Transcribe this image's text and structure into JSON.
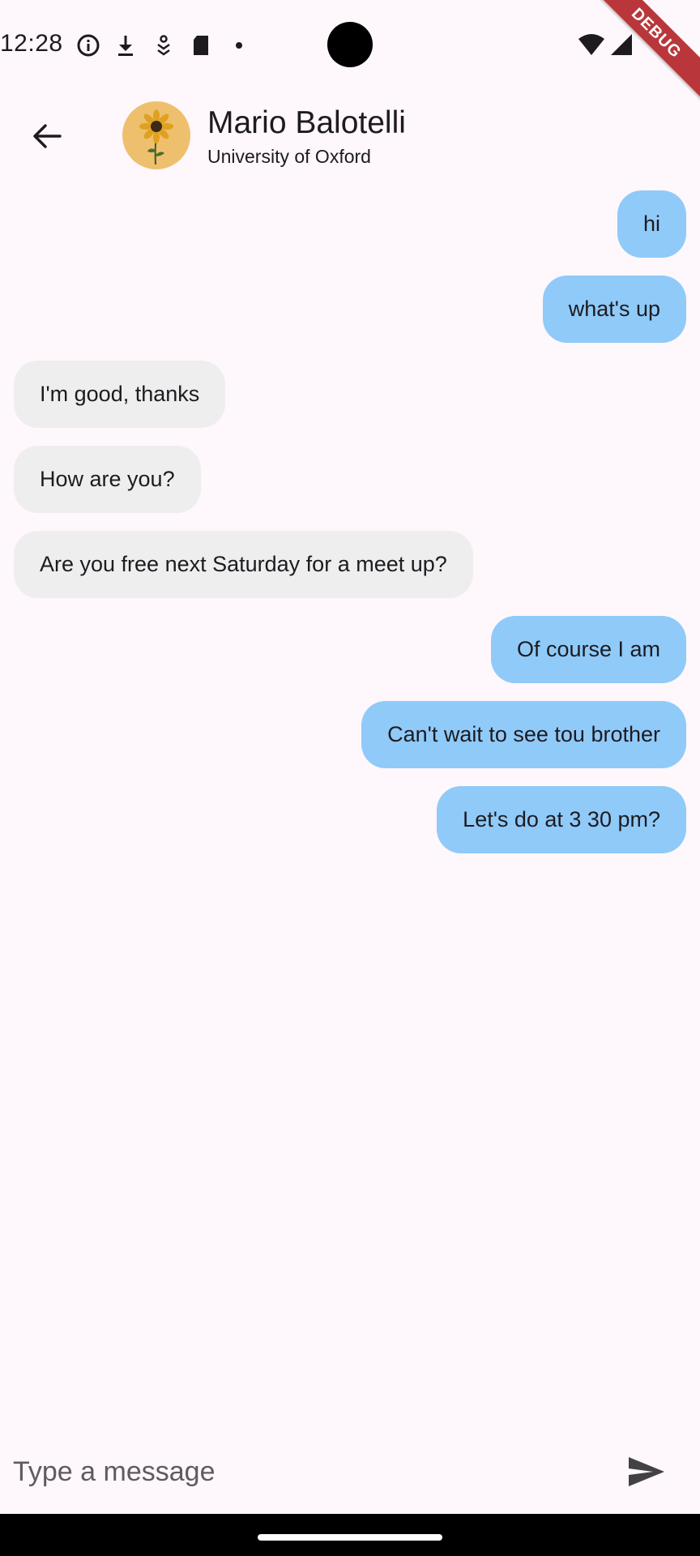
{
  "status_bar": {
    "time": "12:28",
    "icons": [
      "info-icon",
      "download-icon",
      "app-notification-icon",
      "sd-card-icon",
      "dot-icon",
      "wifi-icon",
      "signal-icon"
    ]
  },
  "debug_banner": {
    "label": "DEBUG",
    "color": "#b9373a"
  },
  "header": {
    "name": "Mario Balotelli",
    "subtitle": "University of Oxford",
    "avatar_icon": "sunflower-avatar"
  },
  "messages": [
    {
      "text": "hi",
      "direction": "sent"
    },
    {
      "text": "what's up",
      "direction": "sent"
    },
    {
      "text": "I'm good, thanks",
      "direction": "received"
    },
    {
      "text": "How are you?",
      "direction": "received"
    },
    {
      "text": "Are you free next Saturday for a meet up?",
      "direction": "received"
    },
    {
      "text": "Of course I am",
      "direction": "sent"
    },
    {
      "text": "Can't wait to see tou brother",
      "direction": "sent"
    },
    {
      "text": "Let's do at 3 30 pm?",
      "direction": "sent"
    }
  ],
  "composer": {
    "placeholder": "Type a message",
    "value": ""
  },
  "colors": {
    "sent_bubble": "#90caf9",
    "received_bubble": "#eeeeee",
    "background": "#fef7fb"
  }
}
